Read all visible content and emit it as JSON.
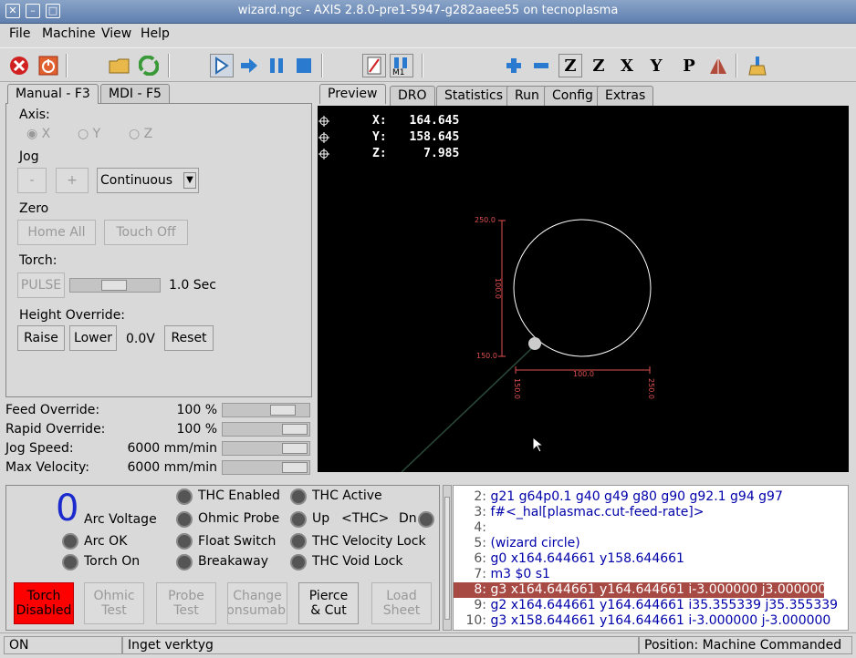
{
  "window": {
    "title": "wizard.ngc - AXIS 2.8.0-pre1-5947-g282aaee55 on tecnoplasma"
  },
  "menu": [
    "File",
    "Machine",
    "View",
    "Help"
  ],
  "tabs_left": [
    "Manual - F3",
    "MDI - F5"
  ],
  "tabs_right": [
    "Preview",
    "DRO",
    "Statistics",
    "Run",
    "Config",
    "Extras"
  ],
  "manual": {
    "axis_label": "Axis:",
    "axes": [
      "X",
      "Y",
      "Z"
    ],
    "jog_label": "Jog",
    "jog_minus": "-",
    "jog_plus": "+",
    "jog_mode": "Continuous",
    "zero_label": "Zero",
    "home_all": "Home All",
    "touch_off": "Touch Off",
    "torch_label": "Torch:",
    "pulse": "PULSE",
    "pulse_value": "1.0 Sec",
    "pulse_level": 0.5,
    "height_label": "Height Override:",
    "raise": "Raise",
    "lower": "Lower",
    "height_value": "0.0V",
    "reset": "Reset"
  },
  "overrides": [
    {
      "label": "Feed Override:",
      "value": "100 %",
      "level": 0.8
    },
    {
      "label": "Rapid Override:",
      "value": "100 %",
      "level": 1.0
    },
    {
      "label": "Jog Speed:",
      "value": "6000 mm/min",
      "level": 1.0
    },
    {
      "label": "Max Velocity:",
      "value": "6000 mm/min",
      "level": 1.0
    }
  ],
  "dro": {
    "x_label": "X:",
    "x": "164.645",
    "y_label": "Y:",
    "y": "158.645",
    "z_label": "Z:",
    "z": "7.985"
  },
  "preview_dims": {
    "top": "250.0",
    "left": "150.0",
    "mid_v": "100.0",
    "bottom_left": "150.0",
    "mid_h": "100.0",
    "right": "250.0"
  },
  "plasma": {
    "arc_voltage_value": "0",
    "arc_voltage_label": "Arc Voltage",
    "leds_left": [
      "THC Enabled",
      "Ohmic Probe",
      "Float Switch",
      "Breakaway"
    ],
    "arc_ok": "Arc OK",
    "torch_on": "Torch On",
    "leds_right": [
      "THC Active",
      "Up",
      "THC Velocity Lock",
      "THC Void Lock"
    ],
    "thc_label": "<THC>",
    "dn_label": "Dn",
    "buttons": [
      {
        "label": "Torch\nDisabled",
        "enabled": true,
        "color": "#ff0000"
      },
      {
        "label": "Ohmic\nTest",
        "enabled": false
      },
      {
        "label": "Probe\nTest",
        "enabled": false
      },
      {
        "label": "Change\nConsumable",
        "enabled": false
      },
      {
        "label": "Pierce\n& Cut",
        "enabled": true
      },
      {
        "label": "Load\nSheet",
        "enabled": false
      }
    ]
  },
  "gcode": [
    {
      "n": "2:",
      "code": "g21 g64p0.1 g40 g49 g80 g90 g92.1 g94 g97"
    },
    {
      "n": "3:",
      "code": "f#<_hal[plasmac.cut-feed-rate]>"
    },
    {
      "n": "4:",
      "code": ""
    },
    {
      "n": "5:",
      "code": "(wizard circle)"
    },
    {
      "n": "6:",
      "code": "g0 x164.644661 y158.644661"
    },
    {
      "n": "7:",
      "code": "m3 $0 s1"
    },
    {
      "n": "8:",
      "code": "g3 x164.644661 y164.644661 i-3.000000 j3.000000",
      "selected": true
    },
    {
      "n": "9:",
      "code": "g2 x164.644661 y164.644661 i35.355339 j35.355339"
    },
    {
      "n": "10:",
      "code": "g3 x158.644661 y164.644661 i-3.000000 j-3.000000"
    }
  ],
  "status": {
    "state": "ON",
    "tool": "Inget verktyg",
    "position": "Position: Machine Commanded"
  },
  "colors": {
    "selected_row": "#a84a44",
    "preview_bg": "#000000",
    "dimension": "#e05050",
    "torch_btn": "#ff0000"
  }
}
